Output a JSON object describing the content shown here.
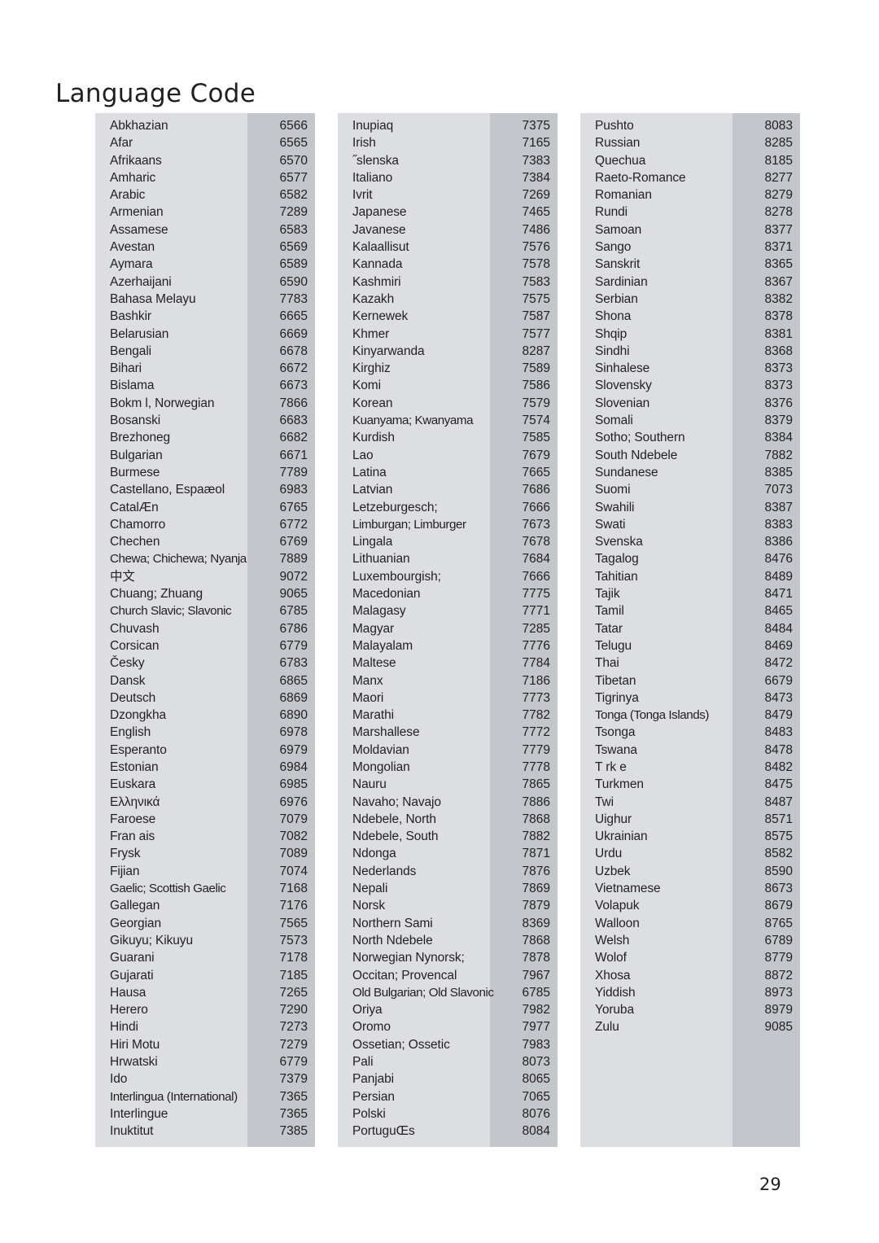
{
  "page": {
    "title": "Language Code",
    "page_number": "29",
    "colors": {
      "panel_background": "#dcdee1",
      "code_band_background": "#c3c6cb",
      "text": "#231f20",
      "page_background": "#ffffff"
    }
  },
  "columns": [
    {
      "id": "column-1",
      "rows": [
        {
          "name": "Abkhazian",
          "code": "6566"
        },
        {
          "name": "Afar",
          "code": "6565"
        },
        {
          "name": "Afrikaans",
          "code": "6570"
        },
        {
          "name": "Amharic",
          "code": "6577"
        },
        {
          "name": "Arabic",
          "code": "6582"
        },
        {
          "name": "Armenian",
          "code": "7289"
        },
        {
          "name": "Assamese",
          "code": "6583"
        },
        {
          "name": "Avestan",
          "code": "6569"
        },
        {
          "name": "Aymara",
          "code": "6589"
        },
        {
          "name": "Azerhaijani",
          "code": "6590"
        },
        {
          "name": "Bahasa Melayu",
          "code": "7783"
        },
        {
          "name": "Bashkir",
          "code": "6665"
        },
        {
          "name": "Belarusian",
          "code": "6669"
        },
        {
          "name": "Bengali",
          "code": "6678"
        },
        {
          "name": "Bihari",
          "code": "6672"
        },
        {
          "name": "Bislama",
          "code": "6673"
        },
        {
          "name": "Bokm l, Norwegian",
          "code": "7866"
        },
        {
          "name": "Bosanski",
          "code": "6683"
        },
        {
          "name": "Brezhoneg",
          "code": "6682"
        },
        {
          "name": "Bulgarian",
          "code": "6671"
        },
        {
          "name": "Burmese",
          "code": "7789"
        },
        {
          "name": "Castellano, Espaæol",
          "code": "6983"
        },
        {
          "name": "CatalÆn",
          "code": "6765"
        },
        {
          "name": "Chamorro",
          "code": "6772"
        },
        {
          "name": "Chechen",
          "code": "6769"
        },
        {
          "name": "Chewa; Chichewa; Nyanja",
          "code": "7889",
          "squeeze": true
        },
        {
          "name": "中文",
          "code": "9072"
        },
        {
          "name": "Chuang; Zhuang",
          "code": "9065"
        },
        {
          "name": "Church Slavic; Slavonic",
          "code": "6785",
          "squeeze": true
        },
        {
          "name": "Chuvash",
          "code": "6786"
        },
        {
          "name": "Corsican",
          "code": "6779"
        },
        {
          "name": "Česky",
          "code": "6783"
        },
        {
          "name": "Dansk",
          "code": "6865"
        },
        {
          "name": "Deutsch",
          "code": "6869"
        },
        {
          "name": "Dzongkha",
          "code": "6890"
        },
        {
          "name": "English",
          "code": "6978"
        },
        {
          "name": "Esperanto",
          "code": "6979"
        },
        {
          "name": "Estonian",
          "code": "6984"
        },
        {
          "name": "Euskara",
          "code": "6985"
        },
        {
          "name": "Ελληνικά",
          "code": "6976"
        },
        {
          "name": "Faroese",
          "code": "7079"
        },
        {
          "name": "Fran ais",
          "code": "7082"
        },
        {
          "name": "Frysk",
          "code": "7089"
        },
        {
          "name": "Fijian",
          "code": "7074"
        },
        {
          "name": "Gaelic; Scottish Gaelic",
          "code": "7168",
          "squeeze": true
        },
        {
          "name": "Gallegan",
          "code": "7176"
        },
        {
          "name": "Georgian",
          "code": "7565"
        },
        {
          "name": "Gikuyu; Kikuyu",
          "code": "7573"
        },
        {
          "name": "Guarani",
          "code": "7178"
        },
        {
          "name": "Gujarati",
          "code": "7185"
        },
        {
          "name": "Hausa",
          "code": "7265"
        },
        {
          "name": "Herero",
          "code": "7290"
        },
        {
          "name": "Hindi",
          "code": "7273"
        },
        {
          "name": "Hiri Motu",
          "code": "7279"
        },
        {
          "name": "Hrwatski",
          "code": "6779"
        },
        {
          "name": "Ido",
          "code": "7379"
        },
        {
          "name": "Interlingua (International)",
          "code": "7365",
          "squeeze": true
        },
        {
          "name": "Interlingue",
          "code": "7365"
        },
        {
          "name": "Inuktitut",
          "code": "7385"
        }
      ]
    },
    {
      "id": "column-2",
      "rows": [
        {
          "name": "Inupiaq",
          "code": "7375"
        },
        {
          "name": "Irish",
          "code": "7165"
        },
        {
          "name": "˝slenska",
          "code": "7383"
        },
        {
          "name": "Italiano",
          "code": "7384"
        },
        {
          "name": "Ivrit",
          "code": "7269"
        },
        {
          "name": "Japanese",
          "code": "7465"
        },
        {
          "name": "Javanese",
          "code": "7486"
        },
        {
          "name": "Kalaallisut",
          "code": "7576"
        },
        {
          "name": "Kannada",
          "code": "7578"
        },
        {
          "name": "Kashmiri",
          "code": "7583"
        },
        {
          "name": "Kazakh",
          "code": "7575"
        },
        {
          "name": "Kernewek",
          "code": "7587"
        },
        {
          "name": "Khmer",
          "code": "7577"
        },
        {
          "name": "Kinyarwanda",
          "code": "8287"
        },
        {
          "name": "Kirghiz",
          "code": "7589"
        },
        {
          "name": "Komi",
          "code": "7586"
        },
        {
          "name": "Korean",
          "code": "7579"
        },
        {
          "name": "Kuanyama; Kwanyama",
          "code": "7574",
          "squeeze": true
        },
        {
          "name": "Kurdish",
          "code": "7585"
        },
        {
          "name": "Lao",
          "code": "7679"
        },
        {
          "name": "Latina",
          "code": "7665"
        },
        {
          "name": "Latvian",
          "code": "7686"
        },
        {
          "name": "Letzeburgesch;",
          "code": "7666"
        },
        {
          "name": "Limburgan; Limburger",
          "code": "7673",
          "squeeze": true
        },
        {
          "name": "Lingala",
          "code": "7678"
        },
        {
          "name": "Lithuanian",
          "code": "7684"
        },
        {
          "name": "Luxembourgish;",
          "code": "7666"
        },
        {
          "name": "Macedonian",
          "code": "7775"
        },
        {
          "name": "Malagasy",
          "code": "7771"
        },
        {
          "name": "Magyar",
          "code": "7285"
        },
        {
          "name": "Malayalam",
          "code": "7776"
        },
        {
          "name": "Maltese",
          "code": "7784"
        },
        {
          "name": "Manx",
          "code": "7186"
        },
        {
          "name": "Maori",
          "code": "7773"
        },
        {
          "name": "Marathi",
          "code": "7782"
        },
        {
          "name": "Marshallese",
          "code": "7772"
        },
        {
          "name": "Moldavian",
          "code": "7779"
        },
        {
          "name": "Mongolian",
          "code": "7778"
        },
        {
          "name": "Nauru",
          "code": "7865"
        },
        {
          "name": "Navaho; Navajo",
          "code": "7886"
        },
        {
          "name": "Ndebele, North",
          "code": "7868"
        },
        {
          "name": "Ndebele, South",
          "code": "7882"
        },
        {
          "name": "Ndonga",
          "code": "7871"
        },
        {
          "name": "Nederlands",
          "code": "7876"
        },
        {
          "name": "Nepali",
          "code": "7869"
        },
        {
          "name": "Norsk",
          "code": "7879"
        },
        {
          "name": "Northern Sami",
          "code": "8369"
        },
        {
          "name": "North Ndebele",
          "code": "7868"
        },
        {
          "name": "Norwegian Nynorsk;",
          "code": "7878"
        },
        {
          "name": "Occitan; Provencal",
          "code": "7967"
        },
        {
          "name": "Old Bulgarian; Old Slavonic",
          "code": "6785",
          "squeeze": true
        },
        {
          "name": "Oriya",
          "code": "7982"
        },
        {
          "name": "Oromo",
          "code": "7977"
        },
        {
          "name": "Ossetian; Ossetic",
          "code": "7983"
        },
        {
          "name": "Pali",
          "code": "8073"
        },
        {
          "name": "Panjabi",
          "code": "8065"
        },
        {
          "name": "Persian",
          "code": "7065"
        },
        {
          "name": "Polski",
          "code": "8076"
        },
        {
          "name": "PortuguŒs",
          "code": "8084"
        }
      ]
    },
    {
      "id": "column-3",
      "rows": [
        {
          "name": "Pushto",
          "code": "8083"
        },
        {
          "name": "Russian",
          "code": "8285"
        },
        {
          "name": "Quechua",
          "code": "8185"
        },
        {
          "name": "Raeto-Romance",
          "code": "8277"
        },
        {
          "name": "Romanian",
          "code": "8279"
        },
        {
          "name": "Rundi",
          "code": "8278"
        },
        {
          "name": "Samoan",
          "code": "8377"
        },
        {
          "name": "Sango",
          "code": "8371"
        },
        {
          "name": "Sanskrit",
          "code": "8365"
        },
        {
          "name": "Sardinian",
          "code": "8367"
        },
        {
          "name": "Serbian",
          "code": "8382"
        },
        {
          "name": "Shona",
          "code": "8378"
        },
        {
          "name": "Shqip",
          "code": "8381"
        },
        {
          "name": "Sindhi",
          "code": "8368"
        },
        {
          "name": "Sinhalese",
          "code": "8373"
        },
        {
          "name": "Slovensky",
          "code": "8373"
        },
        {
          "name": "Slovenian",
          "code": "8376"
        },
        {
          "name": "Somali",
          "code": "8379"
        },
        {
          "name": "Sotho; Southern",
          "code": "8384"
        },
        {
          "name": "South Ndebele",
          "code": "7882"
        },
        {
          "name": "Sundanese",
          "code": "8385"
        },
        {
          "name": "Suomi",
          "code": "7073"
        },
        {
          "name": "Swahili",
          "code": "8387"
        },
        {
          "name": "Swati",
          "code": "8383"
        },
        {
          "name": "Svenska",
          "code": "8386"
        },
        {
          "name": "Tagalog",
          "code": "8476"
        },
        {
          "name": "Tahitian",
          "code": "8489"
        },
        {
          "name": "Tajik",
          "code": "8471"
        },
        {
          "name": "Tamil",
          "code": "8465"
        },
        {
          "name": "Tatar",
          "code": "8484"
        },
        {
          "name": "Telugu",
          "code": "8469"
        },
        {
          "name": "Thai",
          "code": "8472"
        },
        {
          "name": "Tibetan",
          "code": "6679"
        },
        {
          "name": "Tigrinya",
          "code": "8473"
        },
        {
          "name": "Tonga (Tonga Islands)",
          "code": "8479",
          "squeeze": true
        },
        {
          "name": "Tsonga",
          "code": "8483"
        },
        {
          "name": "Tswana",
          "code": "8478"
        },
        {
          "name": "T rk e",
          "code": "8482"
        },
        {
          "name": "Turkmen",
          "code": "8475"
        },
        {
          "name": "Twi",
          "code": "8487"
        },
        {
          "name": "Uighur",
          "code": "8571"
        },
        {
          "name": "Ukrainian",
          "code": "8575"
        },
        {
          "name": "Urdu",
          "code": "8582"
        },
        {
          "name": "Uzbek",
          "code": "8590"
        },
        {
          "name": "Vietnamese",
          "code": "8673"
        },
        {
          "name": "Volapuk",
          "code": "8679"
        },
        {
          "name": "Walloon",
          "code": "8765"
        },
        {
          "name": "Welsh",
          "code": "6789"
        },
        {
          "name": "Wolof",
          "code": "8779"
        },
        {
          "name": "Xhosa",
          "code": "8872"
        },
        {
          "name": "Yiddish",
          "code": "8973"
        },
        {
          "name": "Yoruba",
          "code": "8979"
        },
        {
          "name": "Zulu",
          "code": "9085"
        }
      ]
    }
  ]
}
